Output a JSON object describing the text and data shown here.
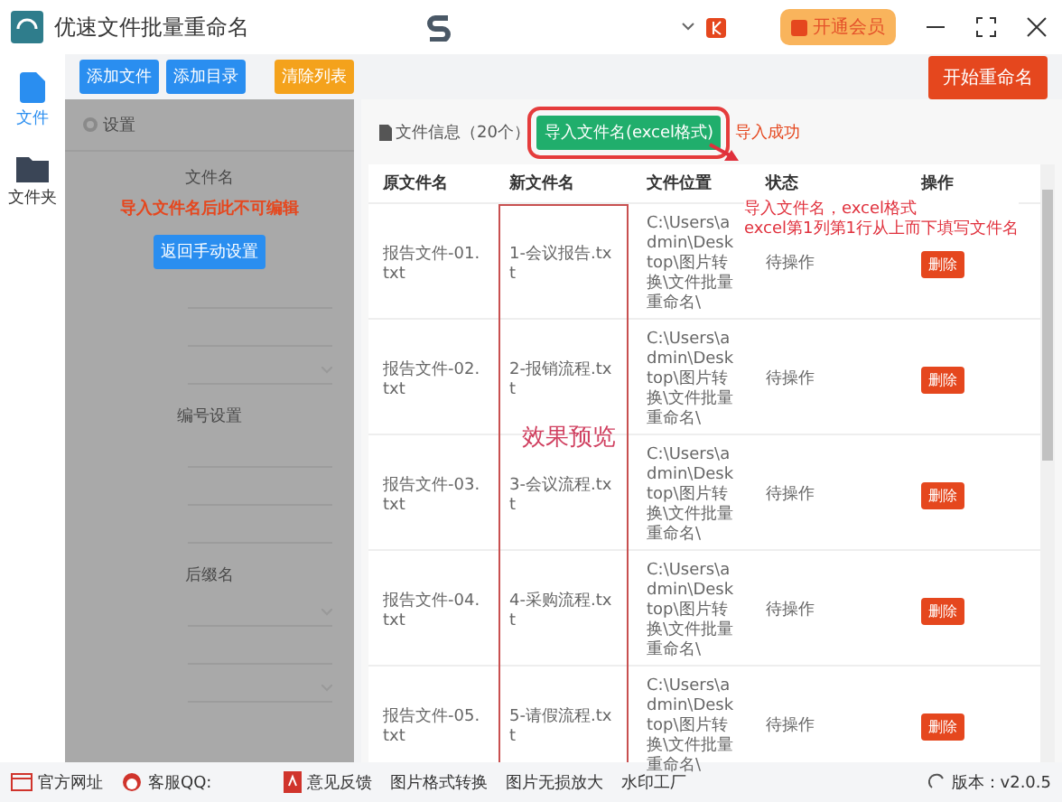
{
  "window": {
    "title": "优速文件批量重命名",
    "vip_button": "开通会员"
  },
  "toolbar": {
    "buttons": [
      {
        "label": "添加文件",
        "kind": "primary"
      },
      {
        "label": "添加目录",
        "kind": "primary"
      },
      {
        "label": "清除列表",
        "kind": "warning"
      }
    ],
    "start_button": "开始重命名"
  },
  "sidebar": {
    "items": [
      {
        "label": "文件",
        "kind": "file",
        "selected": true
      },
      {
        "label": "文件夹",
        "kind": "folder",
        "selected": false
      }
    ]
  },
  "settings_panel": {
    "title": "设置",
    "disabled": true,
    "lock_message": "导入文件名后此不可编辑",
    "return_button": "返回手动设置",
    "sections": [
      {
        "title": "文件名",
        "fields": [
          {
            "kind": "text"
          },
          {
            "kind": "text"
          },
          {
            "kind": "select"
          }
        ]
      },
      {
        "title": "编号设置",
        "fields": [
          {
            "kind": "text"
          },
          {
            "kind": "text"
          },
          {
            "kind": "text"
          }
        ]
      },
      {
        "title": "后缀名",
        "fields": [
          {
            "kind": "select"
          },
          {
            "kind": "text"
          },
          {
            "kind": "select"
          }
        ]
      }
    ]
  },
  "file_info": {
    "label": "文件信息（20个）",
    "import_button": "导入文件名(excel格式)",
    "import_status": "导入成功"
  },
  "table": {
    "columns": [
      "原文件名",
      "新文件名",
      "文件位置",
      "状态",
      "操作"
    ],
    "rows": [
      {
        "original": "报告文件-01.txt",
        "new_name": "1-会议报告.txt",
        "location": "C:\\Users\\admin\\Desktop\\图片转换\\文件批量重命名\\",
        "status": "待操作",
        "action": "删除"
      },
      {
        "original": "报告文件-02.txt",
        "new_name": "2-报销流程.txt",
        "location": "C:\\Users\\admin\\Desktop\\图片转换\\文件批量重命名\\",
        "status": "待操作",
        "action": "删除"
      },
      {
        "original": "报告文件-03.txt",
        "new_name": "3-会议流程.txt",
        "location": "C:\\Users\\admin\\Desktop\\图片转换\\文件批量重命名\\",
        "status": "待操作",
        "action": "删除"
      },
      {
        "original": "报告文件-04.txt",
        "new_name": "4-采购流程.txt",
        "location": "C:\\Users\\admin\\Desktop\\图片转换\\文件批量重命名\\",
        "status": "待操作",
        "action": "删除"
      },
      {
        "original": "报告文件-05.txt",
        "new_name": "5-请假流程.txt",
        "location": "C:\\Users\\admin\\Desktop\\图片转换\\文件批量重命名\\",
        "status": "待操作",
        "action": "删除"
      }
    ]
  },
  "annotations": {
    "callout": [
      "导入文件名，excel格式",
      "excel第1列第1行从上而下填写文件名"
    ],
    "preview_label": "效果预览"
  },
  "status_bar": {
    "links": [
      {
        "label": "官方网址",
        "kind": "web"
      },
      {
        "label": "客服QQ:",
        "kind": "support"
      },
      {
        "label": "意见反馈",
        "kind": "feedback"
      },
      {
        "label": "图片格式转换",
        "kind": "plain"
      },
      {
        "label": "图片无损放大",
        "kind": "plain"
      },
      {
        "label": "水印工厂",
        "kind": "plain"
      }
    ],
    "version": "版本：v2.0.5"
  }
}
